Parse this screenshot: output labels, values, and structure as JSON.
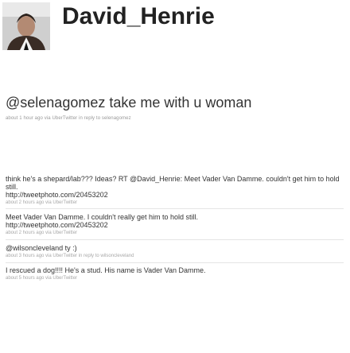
{
  "profile": {
    "username": "David_Henrie"
  },
  "featured": {
    "text": "@selenagomez take me with u woman",
    "meta": "about 1 hour ago via UberTwitter in reply to selenagomez"
  },
  "tweets": [
    {
      "text": "think he's a shepard/lab??? Ideas? RT @David_Henrie: Meet Vader Van Damme. couldn't get him to hold still.",
      "link": "http://tweetphoto.com/20453202",
      "meta": "about 2 hours ago via UberTwitter"
    },
    {
      "text": "Meet Vader Van Damme. I couldn't really get him to hold still.",
      "link": "http://tweetphoto.com/20453202",
      "meta": "about 2 hours ago via UberTwitter"
    },
    {
      "text": "@wilsoncleveland ty :)",
      "link": "",
      "meta": "about 3 hours ago via UberTwitter in reply to wilsoncleveland"
    },
    {
      "text": "I rescued a dog!!!! He's a stud. His name is Vader Van Damme.",
      "link": "",
      "meta": "about 5 hours ago via UberTwitter"
    }
  ]
}
